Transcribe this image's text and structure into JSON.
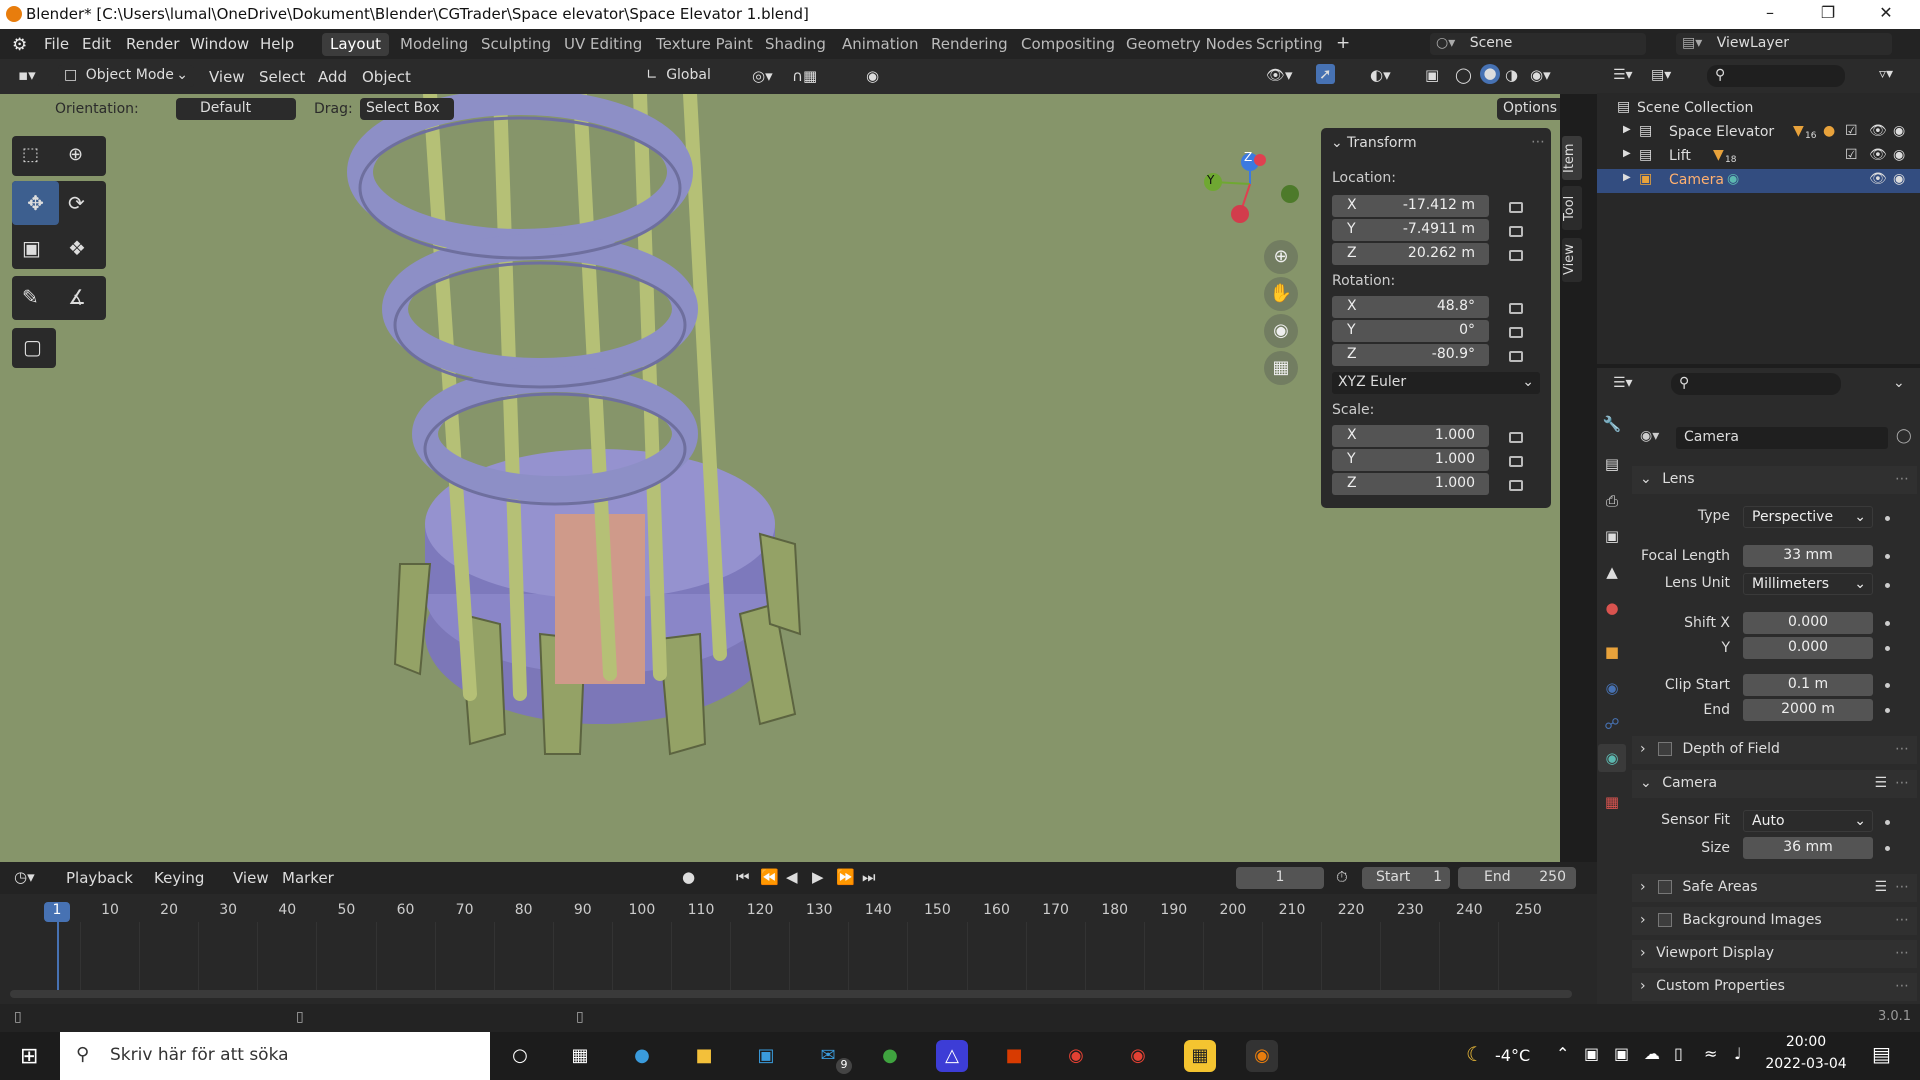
{
  "window": {
    "title": "Blender* [C:\\Users\\lumal\\OneDrive\\Dokument\\Blender\\CGTrader\\Space elevator\\Space Elevator 1.blend]"
  },
  "menu": [
    "File",
    "Edit",
    "Render",
    "Window",
    "Help"
  ],
  "workspaces": [
    "Layout",
    "Modeling",
    "Sculpting",
    "UV Editing",
    "Texture Paint",
    "Shading",
    "Animation",
    "Rendering",
    "Compositing",
    "Geometry Nodes",
    "Scripting"
  ],
  "scene": {
    "name": "Scene",
    "view_layer": "ViewLayer"
  },
  "header3d": {
    "mode": "Object Mode",
    "menus": [
      "View",
      "Select",
      "Add",
      "Object"
    ],
    "transform_orientation": "Global"
  },
  "toolsettings": {
    "orientation_label": "Orientation:",
    "orientation_value": "Default",
    "drag_label": "Drag:",
    "drag_value": "Select Box",
    "options": "Options"
  },
  "npanel": {
    "title": "Transform",
    "location_label": "Location:",
    "location": {
      "x": "-17.412 m",
      "y": "-7.4911 m",
      "z": "20.262 m"
    },
    "rotation_label": "Rotation:",
    "rotation": {
      "x": "48.8°",
      "y": "0°",
      "z": "-80.9°"
    },
    "rotation_mode": "XYZ Euler",
    "scale_label": "Scale:",
    "scale": {
      "x": "1.000",
      "y": "1.000",
      "z": "1.000"
    },
    "tabs": [
      "Item",
      "Tool",
      "View"
    ]
  },
  "axes": {
    "x": "X",
    "y": "Y",
    "z": "Z"
  },
  "outliner": {
    "root": "Scene Collection",
    "items": [
      {
        "name": "Space Elevator",
        "badge": "16"
      },
      {
        "name": "Lift",
        "badge": "18"
      },
      {
        "name": "Camera",
        "badge": ""
      }
    ]
  },
  "properties": {
    "object_name": "Camera",
    "lens_section": "Lens",
    "type_label": "Type",
    "type_value": "Perspective",
    "focal_label": "Focal Length",
    "focal_value": "33 mm",
    "lens_unit_label": "Lens Unit",
    "lens_unit_value": "Millimeters",
    "shiftx_label": "Shift X",
    "shiftx_value": "0.000",
    "shifty_label": "Y",
    "shifty_value": "0.000",
    "clipstart_label": "Clip Start",
    "clipstart_value": "0.1 m",
    "clipend_label": "End",
    "clipend_value": "2000 m",
    "dof_section": "Depth of Field",
    "camera_section": "Camera",
    "sensor_fit_label": "Sensor Fit",
    "sensor_fit_value": "Auto",
    "size_label": "Size",
    "size_value": "36 mm",
    "safe_areas": "Safe Areas",
    "background_images": "Background Images",
    "viewport_display": "Viewport Display",
    "custom_properties": "Custom Properties"
  },
  "timeline": {
    "menus": [
      "Playback",
      "Keying",
      "View",
      "Marker"
    ],
    "current_frame": "1",
    "start_label": "Start",
    "start": "1",
    "end_label": "End",
    "end": "250",
    "ticks": [
      "10",
      "20",
      "30",
      "40",
      "50",
      "60",
      "70",
      "80",
      "90",
      "100",
      "110",
      "120",
      "130",
      "140",
      "150",
      "160",
      "170",
      "180",
      "190",
      "200",
      "210",
      "220",
      "230",
      "240",
      "250"
    ],
    "playhead": "1"
  },
  "status": {
    "version": "3.0.1"
  },
  "taskbar": {
    "search_placeholder": "Skriv här för att söka",
    "temperature": "-4°C",
    "time": "20:00",
    "date": "2022-03-04",
    "mail_badge": "9"
  },
  "colors": {
    "accent": "#4772b3",
    "viewport_bg": "#86956a",
    "tower_ring": "#8a8dc0",
    "pillar": "#a8b36e"
  }
}
